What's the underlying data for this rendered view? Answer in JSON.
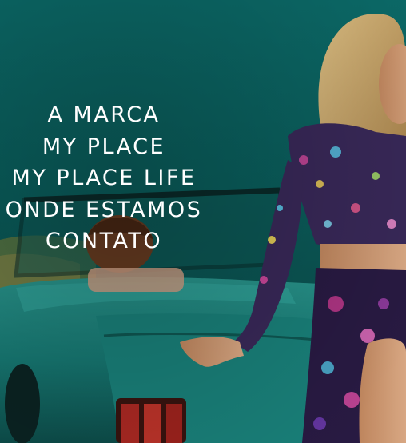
{
  "menu": {
    "items": [
      {
        "label": "A MARCA"
      },
      {
        "label": "MY PLACE"
      },
      {
        "label": "MY PLACE LIFE"
      },
      {
        "label": "ONDE ESTAMOS"
      },
      {
        "label": "CONTATO"
      }
    ]
  },
  "colors": {
    "sky": "#0a6a68",
    "car": "#1f8d86",
    "text": "#ffffff"
  }
}
